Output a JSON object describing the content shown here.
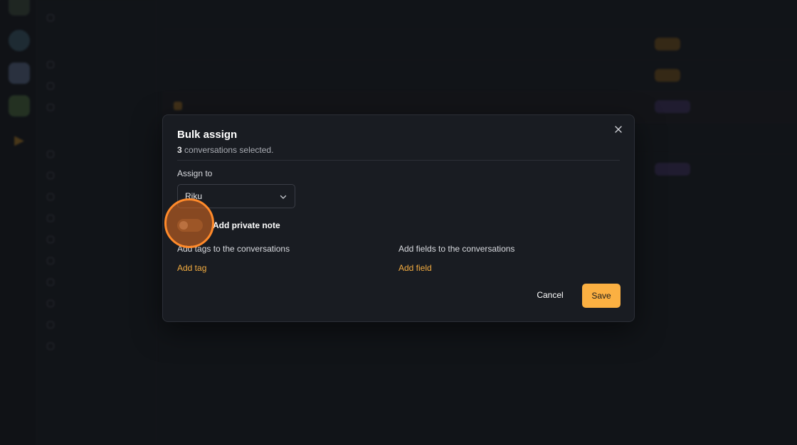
{
  "modal": {
    "title": "Bulk assign",
    "selected_count": "3",
    "selected_text": " conversations selected.",
    "assign_label": "Assign to",
    "assignee_value": "Riku",
    "private_note_label": "Add private note",
    "private_note_on": false,
    "tags_label": "Add tags to the conversations",
    "add_tag": "Add tag",
    "fields_label": "Add fields to the conversations",
    "add_field": "Add field",
    "cancel": "Cancel",
    "save": "Save"
  },
  "colors": {
    "accent": "#fbb042",
    "link": "#f3ac40",
    "click_highlight": "#ff8a2a"
  }
}
